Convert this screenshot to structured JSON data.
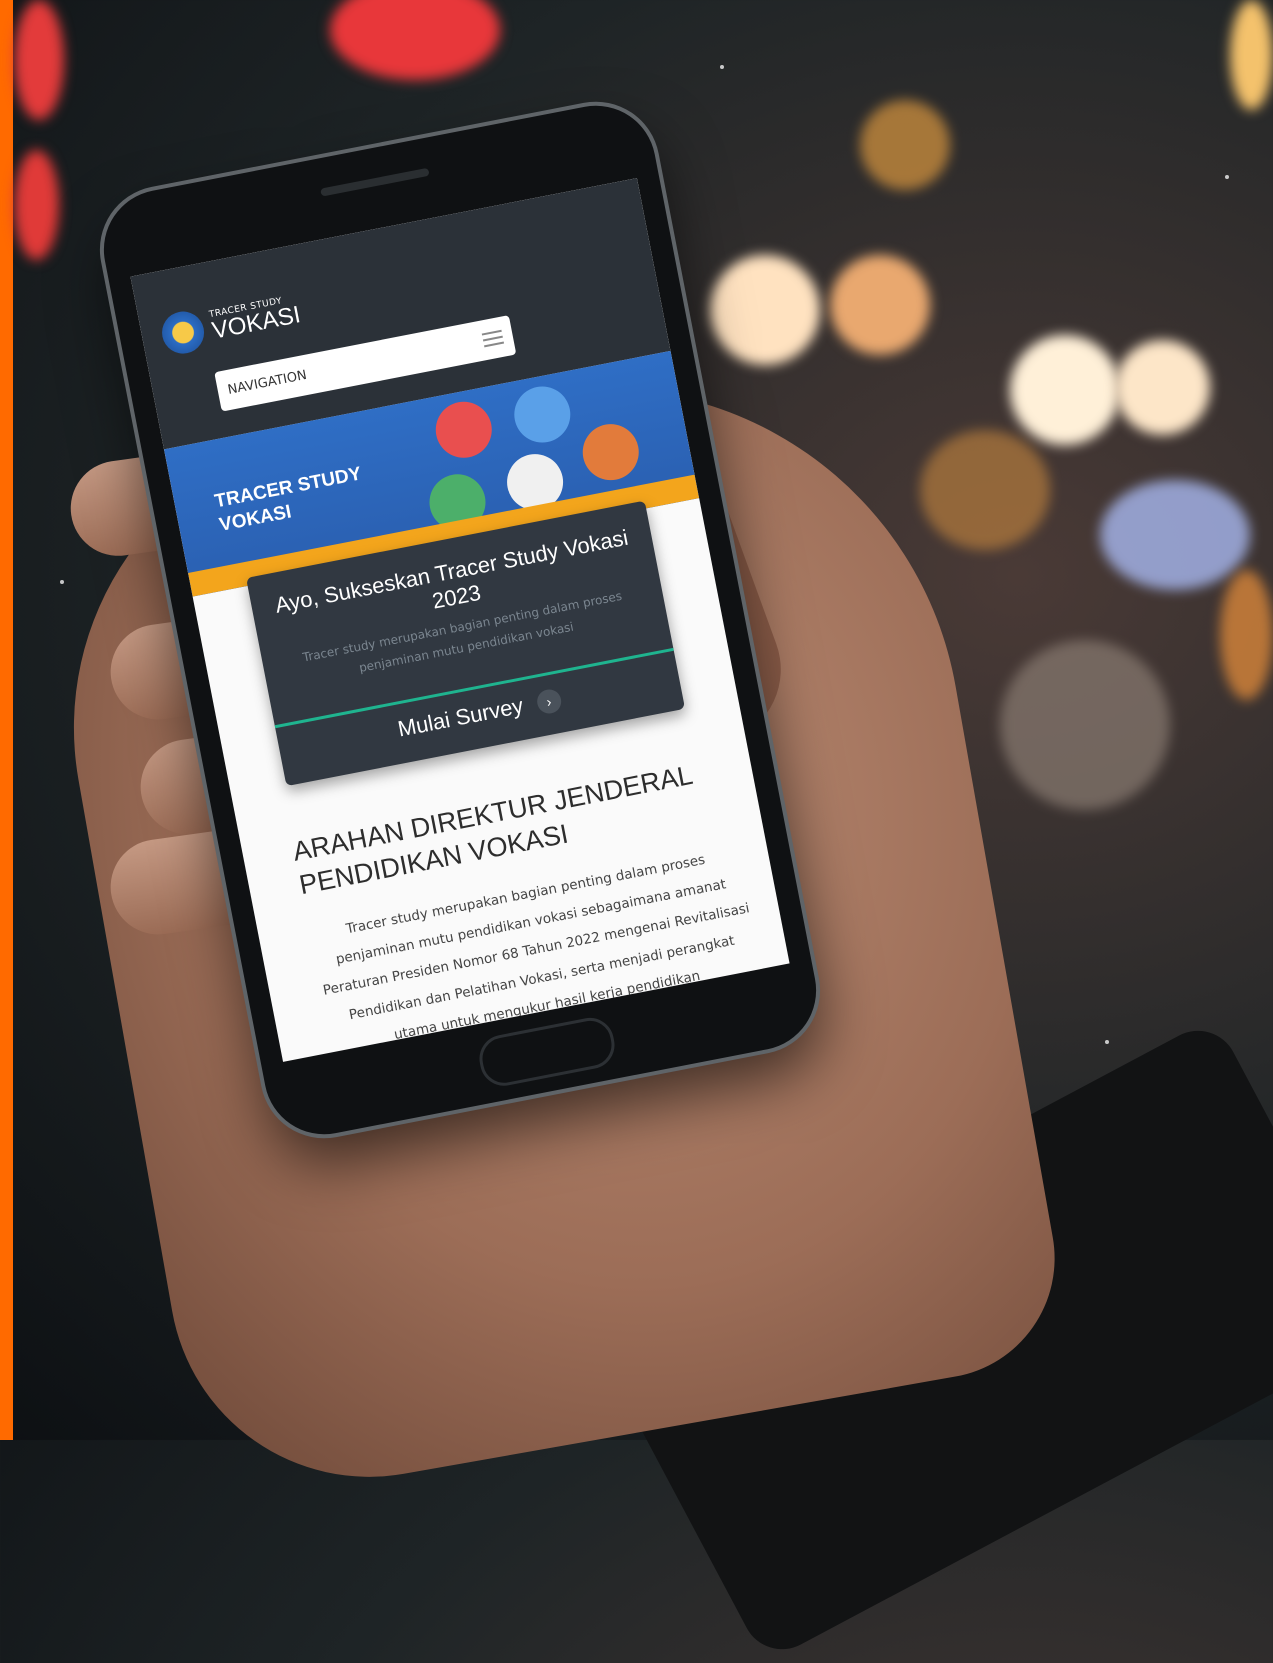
{
  "site": {
    "logo_small": "TRACER STUDY",
    "logo_big": "VOKASI",
    "nav_label": "NAVIGATION"
  },
  "banner": {
    "title_line1": "TRACER STUDY",
    "title_line2": "VOKASI"
  },
  "cta": {
    "title": "Ayo, Sukseskan Tracer Study Vokasi 2023",
    "subtitle": "Tracer study merupakan bagian penting dalam proses penjaminan mutu pendidikan vokasi",
    "button_label": "Mulai Survey",
    "arrow": "›"
  },
  "article": {
    "title": "ARAHAN DIREKTUR JENDERAL PENDIDIKAN VOKASI",
    "body": "Tracer study merupakan bagian penting dalam proses penjaminan mutu pendidikan vokasi sebagaimana amanat Peraturan Presiden Nomor 68 Tahun 2022 mengenai Revitalisasi Pendidikan dan Pelatihan Vokasi, serta menjadi perangkat utama untuk mengukur hasil kerja pendidikan"
  },
  "colors": {
    "brand_orange": "#ff6a00",
    "header_dark": "#2b3138",
    "banner_blue": "#2f6ec5",
    "accent_green": "#1fb48f",
    "card_dark": "#313841",
    "banner_yellow": "#f3a51c"
  }
}
